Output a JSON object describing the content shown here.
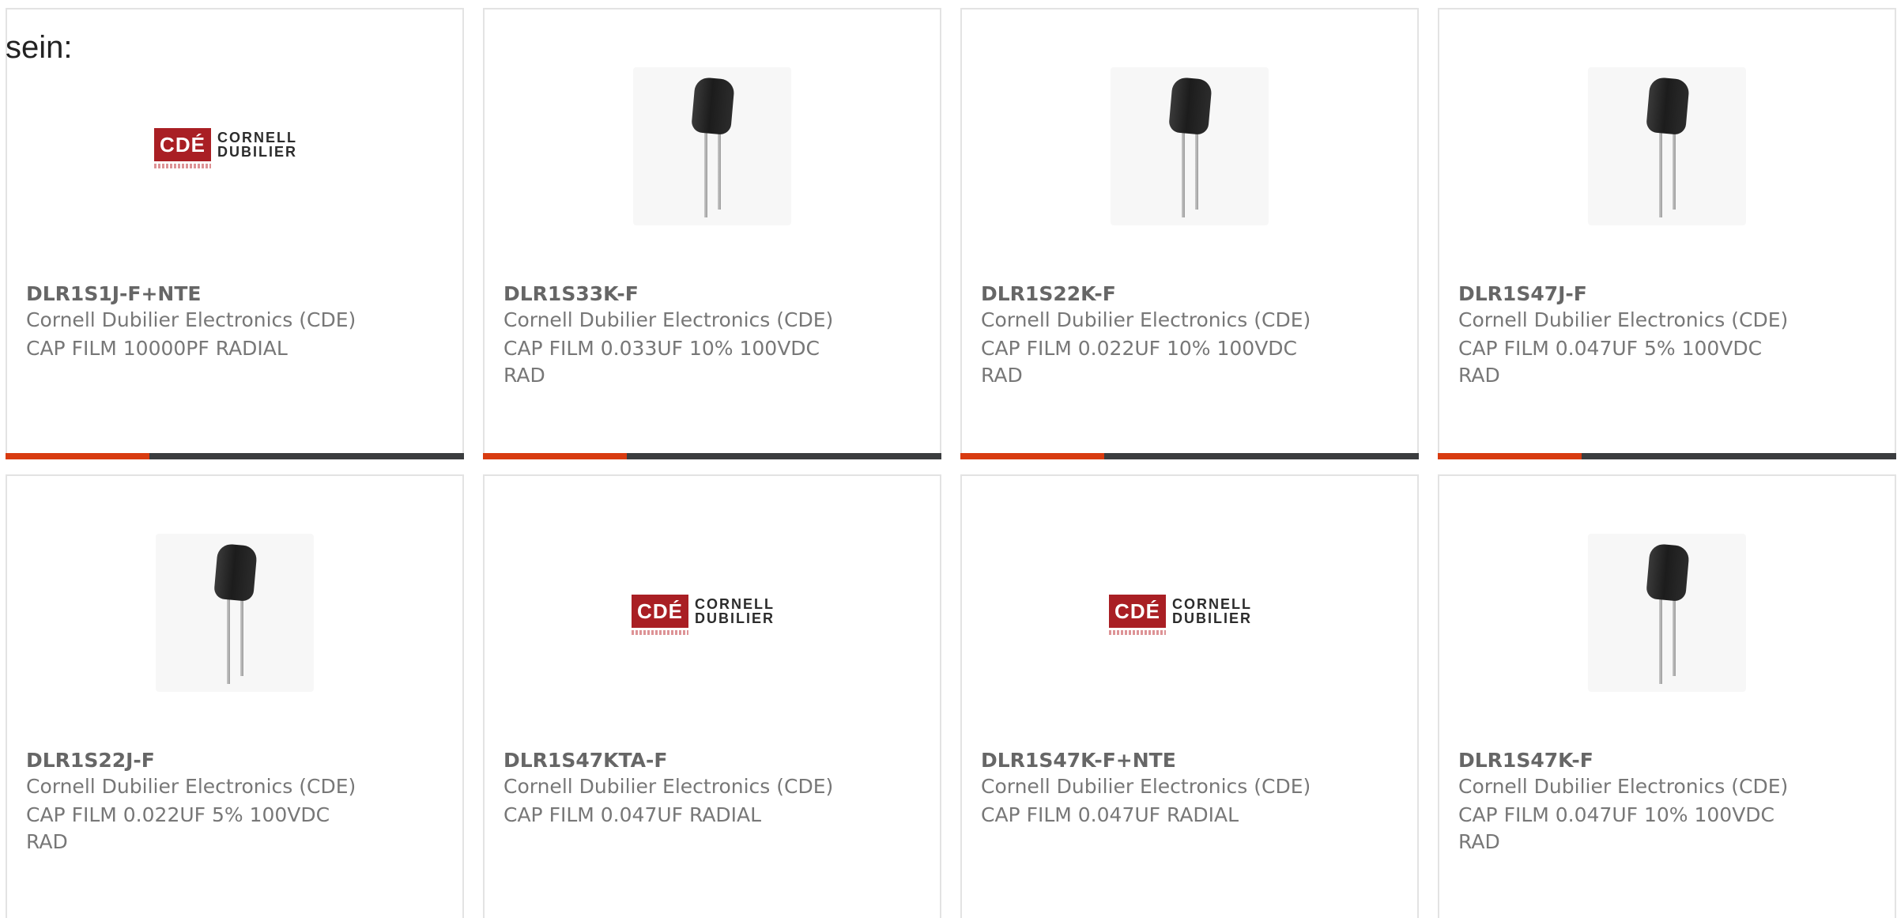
{
  "intro_text": "sein:",
  "logo": {
    "box": "CDÉ",
    "line1": "CORNELL",
    "line2": "DUBILIER"
  },
  "products": [
    {
      "part": "DLR1S1J-F+NTE",
      "manufacturer": "Cornell Dubilier Electronics (CDE)",
      "description": "CAP FILM 10000PF RADIAL",
      "image": "logo"
    },
    {
      "part": "DLR1S33K-F",
      "manufacturer": "Cornell Dubilier Electronics (CDE)",
      "description": "CAP FILM 0.033UF 10% 100VDC RAD",
      "image": "capacitor"
    },
    {
      "part": "DLR1S22K-F",
      "manufacturer": "Cornell Dubilier Electronics (CDE)",
      "description": "CAP FILM 0.022UF 10% 100VDC RAD",
      "image": "capacitor"
    },
    {
      "part": "DLR1S47J-F",
      "manufacturer": "Cornell Dubilier Electronics (CDE)",
      "description": "CAP FILM 0.047UF 5% 100VDC RAD",
      "image": "capacitor"
    },
    {
      "part": "DLR1S22J-F",
      "manufacturer": "Cornell Dubilier Electronics (CDE)",
      "description": "CAP FILM 0.022UF 5% 100VDC RAD",
      "image": "capacitor"
    },
    {
      "part": "DLR1S47KTA-F",
      "manufacturer": "Cornell Dubilier Electronics (CDE)",
      "description": "CAP FILM 0.047UF RADIAL",
      "image": "logo"
    },
    {
      "part": "DLR1S47K-F+NTE",
      "manufacturer": "Cornell Dubilier Electronics (CDE)",
      "description": "CAP FILM 0.047UF RADIAL",
      "image": "logo"
    },
    {
      "part": "DLR1S47K-F",
      "manufacturer": "Cornell Dubilier Electronics (CDE)",
      "description": "CAP FILM 0.047UF 10% 100VDC RAD",
      "image": "capacitor"
    }
  ],
  "colors": {
    "accent": "#d83b10",
    "bar": "#3b3d3f",
    "border": "#e3e3e3",
    "logo_red": "#a91f24"
  }
}
